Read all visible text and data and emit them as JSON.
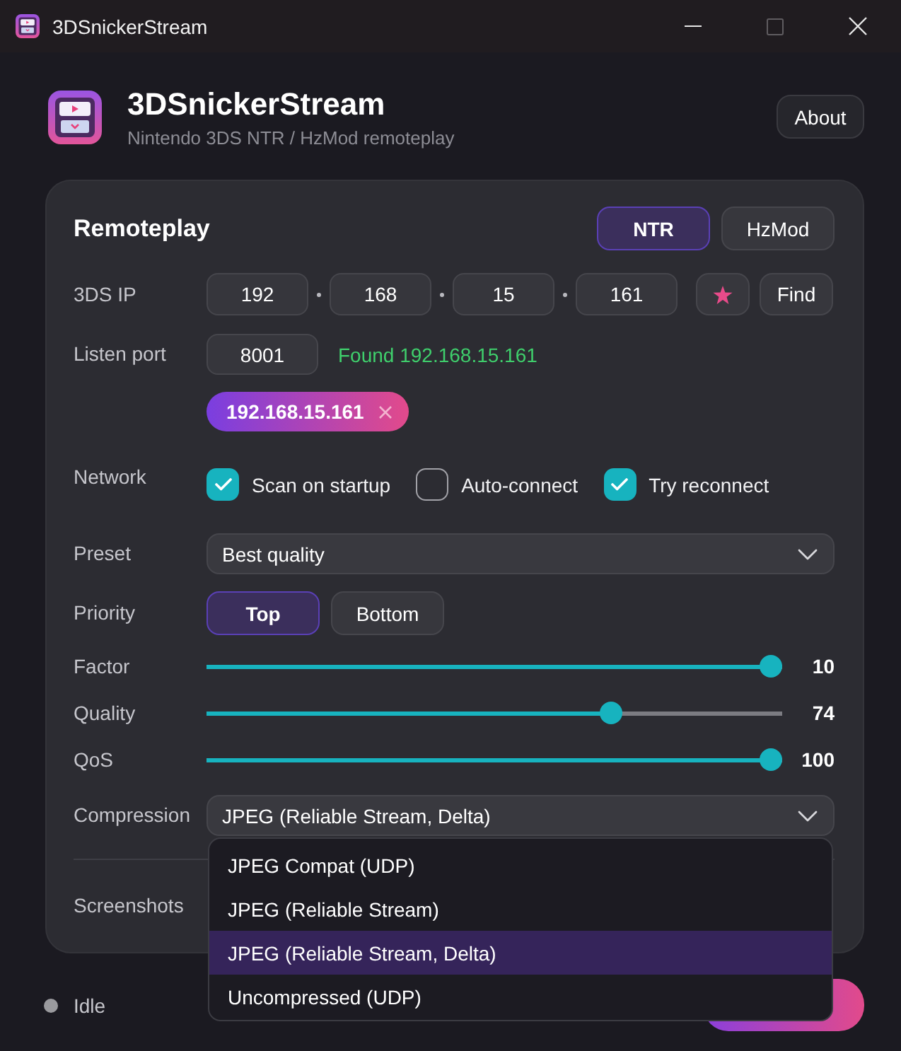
{
  "window": {
    "title": "3DSnickerStream"
  },
  "header": {
    "title": "3DSnickerStream",
    "subtitle": "Nintendo 3DS NTR / HzMod remoteplay",
    "about_button": "About"
  },
  "remoteplay": {
    "title": "Remoteplay",
    "modes": [
      {
        "label": "NTR",
        "selected": true
      },
      {
        "label": "HzMod",
        "selected": false
      }
    ],
    "ip": {
      "label": "3DS IP",
      "octets": [
        "192",
        "168",
        "15",
        "161"
      ],
      "find_button": "Find"
    },
    "port": {
      "label": "Listen port",
      "value": "8001",
      "status": "Found 192.168.15.161"
    },
    "saved_ips": [
      {
        "label": "192.168.15.161"
      }
    ],
    "network": {
      "label": "Network",
      "options": [
        {
          "label": "Scan on startup",
          "checked": true
        },
        {
          "label": "Auto-connect",
          "checked": false
        },
        {
          "label": "Try reconnect",
          "checked": true
        }
      ]
    },
    "preset": {
      "label": "Preset",
      "value": "Best quality"
    },
    "priority": {
      "label": "Priority",
      "options": [
        {
          "label": "Top",
          "selected": true
        },
        {
          "label": "Bottom",
          "selected": false
        }
      ]
    },
    "sliders": [
      {
        "label": "Factor",
        "level": 1,
        "reading": "10"
      },
      {
        "label": "Quality",
        "level": 0.71,
        "reading": "74"
      },
      {
        "label": "QoS",
        "level": 1,
        "reading": "100"
      }
    ],
    "compression": {
      "label": "Compression",
      "value": "JPEG (Reliable Stream, Delta)",
      "expanded": true,
      "options": [
        {
          "label": "JPEG Compat (UDP)",
          "selected": false
        },
        {
          "label": "JPEG (Reliable Stream)",
          "selected": false
        },
        {
          "label": "JPEG (Reliable Stream, Delta)",
          "selected": true
        },
        {
          "label": "Uncompressed (UDP)",
          "selected": false
        }
      ]
    },
    "screenshots": {
      "label": "Screenshots"
    }
  },
  "status_bar": {
    "status": "Idle"
  }
}
